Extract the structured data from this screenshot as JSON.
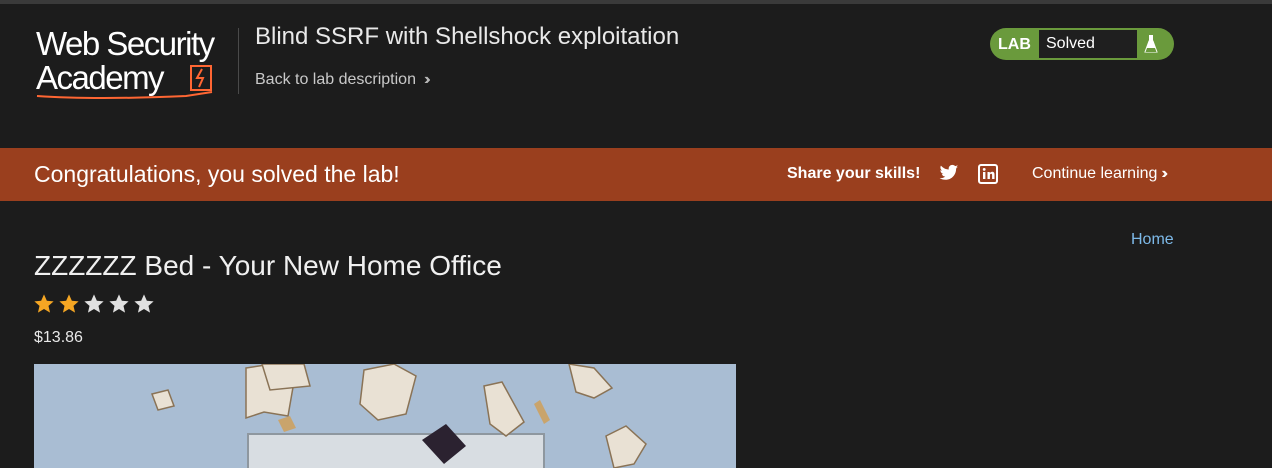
{
  "header": {
    "logo_line1": "Web Security",
    "logo_line2": "Academy",
    "lab_title": "Blind SSRF with Shellshock exploitation",
    "back_link": "Back to lab description",
    "status": {
      "tag": "LAB",
      "text": "Solved",
      "icon": "flask-icon"
    }
  },
  "banner": {
    "message": "Congratulations, you solved the lab!",
    "share_label": "Share your skills!",
    "share_icons": [
      "twitter-icon",
      "linkedin-icon"
    ],
    "continue_label": "Continue learning"
  },
  "nav": {
    "home": "Home"
  },
  "product": {
    "title": "ZZZZZZ Bed - Your New Home Office",
    "rating": 2,
    "rating_max": 5,
    "price": "$13.86"
  },
  "colors": {
    "background": "#1c1c1c",
    "banner": "#9a3f1e",
    "solved_green": "#6a9a3c",
    "link_blue": "#7db9e8",
    "star_filled": "#f5a623",
    "star_empty": "#e0e0e0"
  }
}
